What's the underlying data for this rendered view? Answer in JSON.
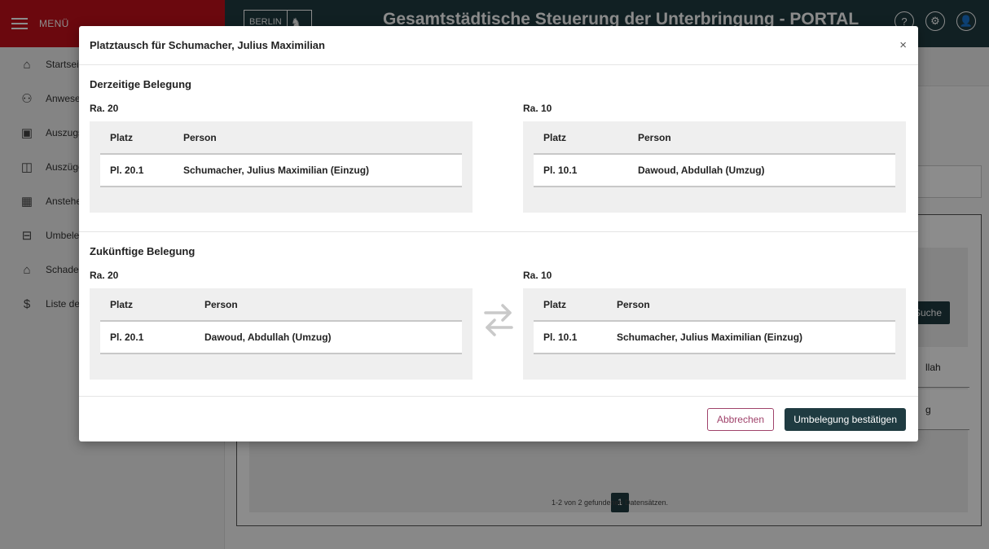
{
  "app": {
    "menu_label": "MENÜ",
    "logo_text": "BERLIN",
    "title": "Gesamtstädtische Steuerung der Unterbringung - PORTAL"
  },
  "sidebar": {
    "items": [
      {
        "label": "Startseite",
        "icon": "home-icon"
      },
      {
        "label": "Anwesenheit",
        "icon": "person-check-icon"
      },
      {
        "label": "Auszugsmeldung",
        "icon": "calendar-check-icon"
      },
      {
        "label": "Auszüge",
        "icon": "folder-icon"
      },
      {
        "label": "Anstehende",
        "icon": "building-icon"
      },
      {
        "label": "Umbelegung",
        "icon": "bed-icon"
      },
      {
        "label": "Schadensmeldung",
        "icon": "house-warning-icon"
      },
      {
        "label": "Liste der",
        "icon": "document-dollar-icon"
      }
    ]
  },
  "background": {
    "search_button": "Suche",
    "row_fragments": [
      "llah",
      "g"
    ],
    "page_number": "1",
    "results_count": "1-2 von 2 gefundenen Datensätzen."
  },
  "modal": {
    "title": "Platztausch für Schumacher, Julius Maximilian",
    "close_label": "×",
    "current": {
      "title": "Derzeitige Belegung",
      "left": {
        "room": "Ra. 20",
        "headers": [
          "Platz",
          "Person"
        ],
        "rows": [
          {
            "platz": "Pl. 20.1",
            "person": "Schumacher, Julius Maximilian (Einzug)"
          }
        ]
      },
      "right": {
        "room": "Ra. 10",
        "headers": [
          "Platz",
          "Person"
        ],
        "rows": [
          {
            "platz": "Pl. 10.1",
            "person": "Dawoud, Abdullah (Umzug)"
          }
        ]
      }
    },
    "future": {
      "title": "Zukünftige Belegung",
      "left": {
        "room": "Ra. 20",
        "headers": [
          "Platz",
          "Person"
        ],
        "rows": [
          {
            "platz": "Pl. 20.1",
            "person": "Dawoud, Abdullah (Umzug)"
          }
        ]
      },
      "right": {
        "room": "Ra. 10",
        "headers": [
          "Platz",
          "Person"
        ],
        "rows": [
          {
            "platz": "Pl. 10.1",
            "person": "Schumacher, Julius Maximilian (Einzug)"
          }
        ]
      }
    },
    "cancel_label": "Abbrechen",
    "confirm_label": "Umbelegung bestätigen"
  },
  "colors": {
    "brand_red": "#c4101a",
    "header_dark": "#1f3b41",
    "cancel_accent": "#a0436b"
  }
}
